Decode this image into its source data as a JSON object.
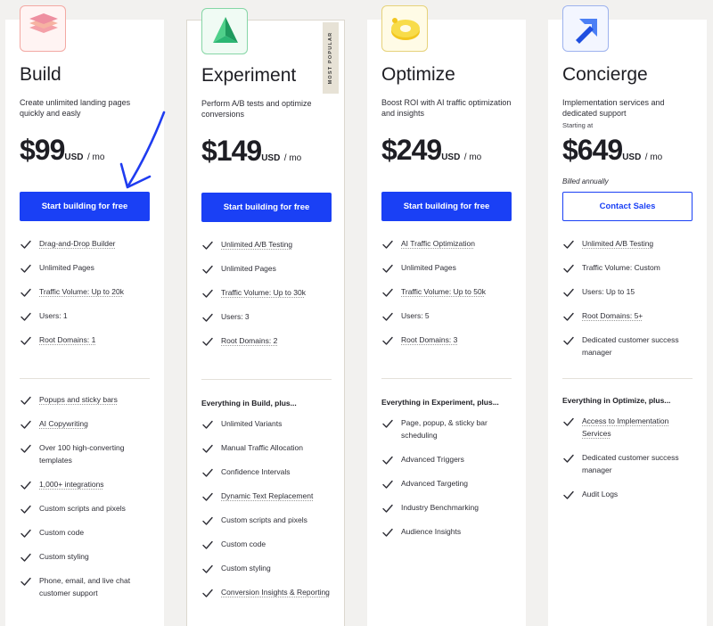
{
  "colors": {
    "accent": "#1a40f5",
    "annotation": "#1f3cf0"
  },
  "plans": [
    {
      "name": "Build",
      "description": "Create unlimited landing pages quickly and easly",
      "price": "$99",
      "currency": "USD",
      "period": "/ mo",
      "cta": "Start building for free",
      "icon": "stacked-layers-icon",
      "core_features": [
        {
          "text": "Drag-and-Drop Builder",
          "u": true
        },
        {
          "text": "Unlimited Pages",
          "u": false
        },
        {
          "text": "Traffic Volume: Up to 20k",
          "u": true
        },
        {
          "text": "Users: 1",
          "u": false
        },
        {
          "text": "Root Domains: 1",
          "u": true
        }
      ],
      "extras_heading": "",
      "extras": [
        {
          "text": "Popups and sticky bars",
          "u": true
        },
        {
          "text": "AI Copywriting",
          "u": true
        },
        {
          "text": "Over 100 high-converting templates",
          "u": false
        },
        {
          "text": "1,000+ integrations",
          "u": true
        },
        {
          "text": "Custom scripts and pixels",
          "u": false
        },
        {
          "text": "Custom code",
          "u": false
        },
        {
          "text": "Custom styling",
          "u": false
        },
        {
          "text": "Phone, email, and live chat customer support",
          "u": false
        }
      ]
    },
    {
      "name": "Experiment",
      "description": "Perform A/B tests and optimize conversions",
      "badge": "MOST POPULAR",
      "price": "$149",
      "currency": "USD",
      "period": "/ mo",
      "cta": "Start building for free",
      "icon": "prism-icon",
      "core_features": [
        {
          "text": "Unlimited A/B Testing",
          "u": true
        },
        {
          "text": "Unlimited Pages",
          "u": false
        },
        {
          "text": "Traffic Volume: Up to 30k",
          "u": true
        },
        {
          "text": "Users: 3",
          "u": false
        },
        {
          "text": "Root Domains: 2",
          "u": true
        }
      ],
      "extras_heading": "Everything in Build, plus...",
      "extras": [
        {
          "text": "Unlimited Variants",
          "u": false
        },
        {
          "text": "Manual Traffic Allocation",
          "u": false
        },
        {
          "text": "Confidence Intervals",
          "u": false
        },
        {
          "text": "Dynamic Text Replacement",
          "u": true
        },
        {
          "text": "Custom scripts and pixels",
          "u": false
        },
        {
          "text": "Custom code",
          "u": false
        },
        {
          "text": "Custom styling",
          "u": false
        },
        {
          "text": "Conversion Insights & Reporting",
          "u": true
        }
      ]
    },
    {
      "name": "Optimize",
      "description": "Boost ROI with AI traffic optimization and insights",
      "price": "$249",
      "currency": "USD",
      "period": "/ mo",
      "cta": "Start building for free",
      "icon": "ring-icon",
      "core_features": [
        {
          "text": "AI Traffic Optimization",
          "u": true
        },
        {
          "text": "Unlimited Pages",
          "u": false
        },
        {
          "text": "Traffic Volume: Up to 50k",
          "u": true
        },
        {
          "text": "Users: 5",
          "u": false
        },
        {
          "text": "Root Domains: 3",
          "u": true
        }
      ],
      "extras_heading": "Everything in Experiment, plus...",
      "extras": [
        {
          "text": "Page, popup, & sticky bar scheduling",
          "u": false
        },
        {
          "text": "Advanced Triggers",
          "u": false
        },
        {
          "text": "Advanced Targeting",
          "u": false
        },
        {
          "text": "Industry Benchmarking",
          "u": false
        },
        {
          "text": "Audience Insights",
          "u": false
        }
      ]
    },
    {
      "name": "Concierge",
      "description": "Implementation services and dedicated support",
      "starting": "Starting at",
      "price": "$649",
      "currency": "USD",
      "period": "/ mo",
      "billed": "Billed annually",
      "cta": "Contact Sales",
      "icon": "arrow-up-right-icon",
      "core_features": [
        {
          "text": "Unlimited A/B Testing",
          "u": true
        },
        {
          "text": "Traffic Volume: Custom",
          "u": false
        },
        {
          "text": "Users: Up to 15",
          "u": false
        },
        {
          "text": "Root Domains: 5+",
          "u": true
        },
        {
          "text": "Dedicated customer success manager",
          "u": false
        }
      ],
      "extras_heading": "Everything in Optimize, plus...",
      "extras": [
        {
          "text": "Access to Implementation Services",
          "u": true
        },
        {
          "text": "Dedicated customer success manager",
          "u": false
        },
        {
          "text": "Audit Logs",
          "u": false
        }
      ]
    }
  ]
}
